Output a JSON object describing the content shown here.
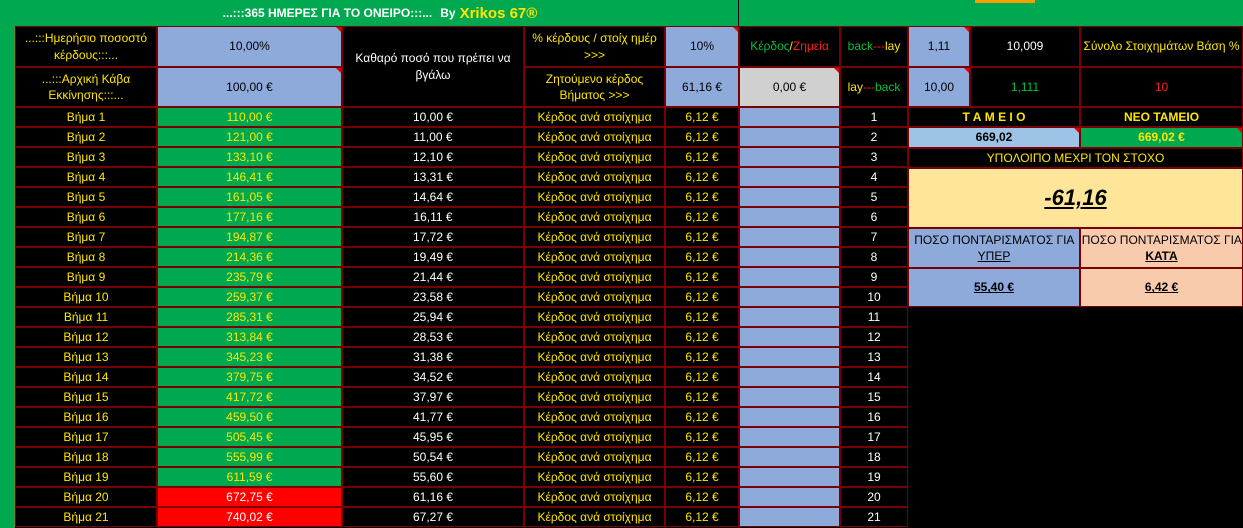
{
  "title": {
    "prefix": "...:::365 ΗΜΕΡΕΣ ΓΙΑ ΤΟ ΟΝΕΙΡΟ:::...",
    "by": "By",
    "author": "Xrikos 67®"
  },
  "header": {
    "daily_pct_label": "...:::Ημερήσιο ποσοστό κέρδους:::...",
    "daily_pct_value": "10,00%",
    "net_amount_label": "Καθαρό ποσό που πρέπει να βγάλω",
    "pct_per_bet_label": "% κέρδους / στοίχ ημέρ >>>",
    "pct_per_bet_value": "10%",
    "profit_loss_profit": "Κέρδος",
    "profit_loss_sep": "/",
    "profit_loss_loss": "Ζημεία",
    "back_lay_1": {
      "back": "back",
      "dashes": "---",
      "lay": "lay"
    },
    "odds_1": "1,11",
    "value_1": "10,009",
    "sum_bets_label": "Σύνολο Στοιχημάτων Βάση %",
    "initial_bank_label": "...:::Αρχική Κάβα Εκκίνησης:::...",
    "initial_bank_value": "100,00 €",
    "target_profit_label": "Ζητούμενο κέρδος Βήματος >>>",
    "target_profit_value": "61,16 €",
    "profit_loss_value": "0,00 €",
    "lay_back_2": {
      "lay": "lay",
      "dashes": "---",
      "back": "back"
    },
    "odds_2": "10,00",
    "value_2": "1,111",
    "sum_bets_value": "10"
  },
  "rows": [
    {
      "step": "Βήμα 1",
      "bank": "110,00 €",
      "net": "10,00 €",
      "label": "Κέρδος ανά στοίχημα",
      "per": "6,12 €",
      "num": "1",
      "status": "green"
    },
    {
      "step": "Βήμα 2",
      "bank": "121,00 €",
      "net": "11,00 €",
      "label": "Κέρδος ανά στοίχημα",
      "per": "6,12 €",
      "num": "2",
      "status": "green"
    },
    {
      "step": "Βήμα 3",
      "bank": "133,10 €",
      "net": "12,10 €",
      "label": "Κέρδος ανά στοίχημα",
      "per": "6,12 €",
      "num": "3",
      "status": "green"
    },
    {
      "step": "Βήμα 4",
      "bank": "146,41 €",
      "net": "13,31 €",
      "label": "Κέρδος ανά στοίχημα",
      "per": "6,12 €",
      "num": "4",
      "status": "green"
    },
    {
      "step": "Βήμα 5",
      "bank": "161,05 €",
      "net": "14,64 €",
      "label": "Κέρδος ανά στοίχημα",
      "per": "6,12 €",
      "num": "5",
      "status": "green"
    },
    {
      "step": "Βήμα 6",
      "bank": "177,16 €",
      "net": "16,11 €",
      "label": "Κέρδος ανά στοίχημα",
      "per": "6,12 €",
      "num": "6",
      "status": "green"
    },
    {
      "step": "Βήμα 7",
      "bank": "194,87 €",
      "net": "17,72 €",
      "label": "Κέρδος ανά στοίχημα",
      "per": "6,12 €",
      "num": "7",
      "status": "green"
    },
    {
      "step": "Βήμα 8",
      "bank": "214,36 €",
      "net": "19,49 €",
      "label": "Κέρδος ανά στοίχημα",
      "per": "6,12 €",
      "num": "8",
      "status": "green"
    },
    {
      "step": "Βήμα 9",
      "bank": "235,79 €",
      "net": "21,44 €",
      "label": "Κέρδος ανά στοίχημα",
      "per": "6,12 €",
      "num": "9",
      "status": "green"
    },
    {
      "step": "Βήμα 10",
      "bank": "259,37 €",
      "net": "23,58 €",
      "label": "Κέρδος ανά στοίχημα",
      "per": "6,12 €",
      "num": "10",
      "status": "green"
    },
    {
      "step": "Βήμα 11",
      "bank": "285,31 €",
      "net": "25,94 €",
      "label": "Κέρδος ανά στοίχημα",
      "per": "6,12 €",
      "num": "11",
      "status": "green"
    },
    {
      "step": "Βήμα 12",
      "bank": "313,84 €",
      "net": "28,53 €",
      "label": "Κέρδος ανά στοίχημα",
      "per": "6,12 €",
      "num": "12",
      "status": "green"
    },
    {
      "step": "Βήμα 13",
      "bank": "345,23 €",
      "net": "31,38 €",
      "label": "Κέρδος ανά στοίχημα",
      "per": "6,12 €",
      "num": "13",
      "status": "green"
    },
    {
      "step": "Βήμα 14",
      "bank": "379,75 €",
      "net": "34,52 €",
      "label": "Κέρδος ανά στοίχημα",
      "per": "6,12 €",
      "num": "14",
      "status": "green"
    },
    {
      "step": "Βήμα 15",
      "bank": "417,72 €",
      "net": "37,97 €",
      "label": "Κέρδος ανά στοίχημα",
      "per": "6,12 €",
      "num": "15",
      "status": "green"
    },
    {
      "step": "Βήμα 16",
      "bank": "459,50 €",
      "net": "41,77 €",
      "label": "Κέρδος ανά στοίχημα",
      "per": "6,12 €",
      "num": "16",
      "status": "green"
    },
    {
      "step": "Βήμα 17",
      "bank": "505,45 €",
      "net": "45,95 €",
      "label": "Κέρδος ανά στοίχημα",
      "per": "6,12 €",
      "num": "17",
      "status": "green"
    },
    {
      "step": "Βήμα 18",
      "bank": "555,99 €",
      "net": "50,54 €",
      "label": "Κέρδος ανά στοίχημα",
      "per": "6,12 €",
      "num": "18",
      "status": "green"
    },
    {
      "step": "Βήμα 19",
      "bank": "611,59 €",
      "net": "55,60 €",
      "label": "Κέρδος ανά στοίχημα",
      "per": "6,12 €",
      "num": "19",
      "status": "green"
    },
    {
      "step": "Βήμα 20",
      "bank": "672,75 €",
      "net": "61,16 €",
      "label": "Κέρδος ανά στοίχημα",
      "per": "6,12 €",
      "num": "20",
      "status": "red"
    },
    {
      "step": "Βήμα 21",
      "bank": "740,02 €",
      "net": "67,27 €",
      "label": "Κέρδος ανά στοίχημα",
      "per": "6,12 €",
      "num": "21",
      "status": "red"
    }
  ],
  "panel": {
    "tameio_label": "Τ Α Μ Ε Ι Ο",
    "tameio_value": "669,02",
    "neo_tameio_label": "ΝΕΟ ΤΑΜΕΙΟ",
    "neo_tameio_value": "669,02 €",
    "remaining_label": "ΥΠΟΛΟΙΠΟ ΜΕΧΡΙ ΤΟΝ ΣΤΟΧΟ",
    "remaining_value": "-61,16",
    "over_label_prefix": "ΠΟΣΟ ΠΟΝΤΑΡΙΣΜΑΤΟΣ ΓΙΑ",
    "over_label_key": "ΥΠΕΡ",
    "under_label_prefix": "ΠΟΣΟ ΠΟΝΤΑΡΙΣΜΑΤΟΣ ΓΙΑ",
    "under_label_key": "ΚΑΤΆ",
    "over_value": "55,40 €",
    "under_value": "6,42 €"
  },
  "colors": {
    "green": "#00a94f",
    "red": "#ff0000",
    "blue": "#8eaadb",
    "yellow_text": "#ffe600",
    "border": "#7a0000"
  }
}
